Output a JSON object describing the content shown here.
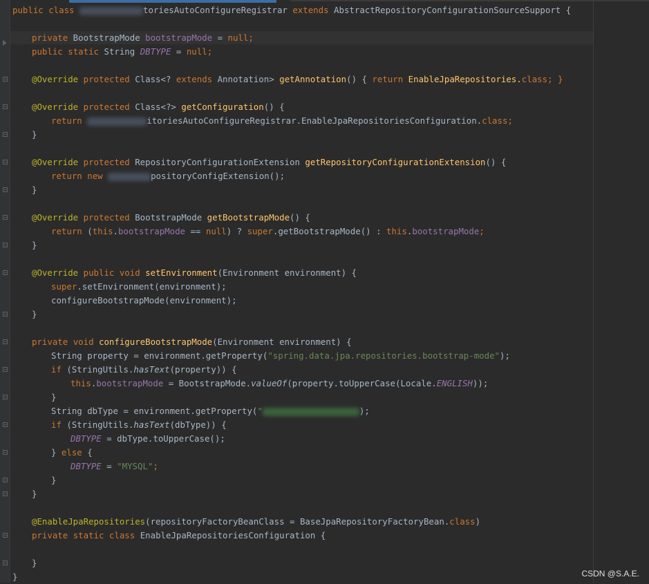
{
  "code": {
    "l1_pre": "public class",
    "l1_name": "toriesAutoConfigureRegistrar",
    "l1_ext": "extends",
    "l1_base": "AbstractRepositoryConfigurationSourceSupport {",
    "l3_field": "private BootstrapMode bootstrapMode = null;",
    "l4_field": "public static String DBTYPE = null;",
    "annotation_override": "@Override",
    "kw_protected": "protected",
    "kw_public": "public",
    "kw_private": "private",
    "kw_return": "return",
    "kw_new": "new",
    "kw_void": "void",
    "kw_static": "static",
    "kw_class": "class",
    "kw_this": "this",
    "kw_super": "super",
    "kw_null": "null",
    "kw_if": "if",
    "kw_else": "else",
    "l6_type": "Class<?",
    "l6_ext": "extends",
    "l6_rest": "Annotation>",
    "l6_fn": "getAnnotation",
    "l6_body_open": "() {",
    "l6_ret_val": "EnableJpaRepositories.",
    "l6_body_close": "; }",
    "l8_type": "Class<?>",
    "l8_fn": "getConfiguration",
    "l8_tail": "() {",
    "l9_ret_tail": "itoriesAutoConfigureRegistrar.EnableJpaRepositoriesConfiguration.",
    "l12_type": "RepositoryConfigurationExtension",
    "l12_fn": "getRepositoryConfigurationExtension",
    "l13_tail": "positoryConfigExtension();",
    "l16_type": "BootstrapMode",
    "l16_fn": "getBootstrapMode",
    "l17_a": "(",
    "l17_field": "bootstrapMode",
    "l17_b": " ==",
    "l17_c": ") ?",
    "l17_d": ".getBootstrapMode() :",
    "l20_fn": "setEnvironment",
    "l20_args": "(Environment environment) {",
    "l21_tail": ".setEnvironment(environment);",
    "l22": "configureBootstrapMode(environment);",
    "l25_fn": "configureBootstrapMode",
    "l25_args": "(Environment environment) {",
    "l26_a": "String property = environment.getProperty(",
    "l26_str": "\"spring.data.jpa.repositories.bootstrap-mode\"",
    "l26_b": ");",
    "l27_a": "(StringUtils.",
    "l27_fn": "hasText",
    "l27_b": "(property)) {",
    "l28_a": " = BootstrapMode.",
    "l28_fn": "valueOf",
    "l28_b": "(property.toUpperCase(Locale.",
    "l28_const": "ENGLISH",
    "l28_c": "));",
    "l30_a": "String dbType = environment.getProperty(",
    "l30_str": "\"",
    "l30_b": ");",
    "l31_b": "(dbType)) {",
    "l32_const": "DBTYPE",
    "l32_tail": " = dbType.toUpperCase();",
    "l33_a": "} ",
    "l33_b": " {",
    "l34_str": "\"MYSQL\"",
    "l37_ann": "@EnableJpaRepositories",
    "l37_param": "repositoryFactoryBeanClass",
    "l37_mid": " = BaseJpaRepositoryFactoryBean.",
    "l38_tail": "EnableJpaRepositoriesConfiguration {",
    "brace_open": "{",
    "brace_close": "}",
    "semicolon": ";"
  },
  "watermark": "CSDN @S.A.E."
}
